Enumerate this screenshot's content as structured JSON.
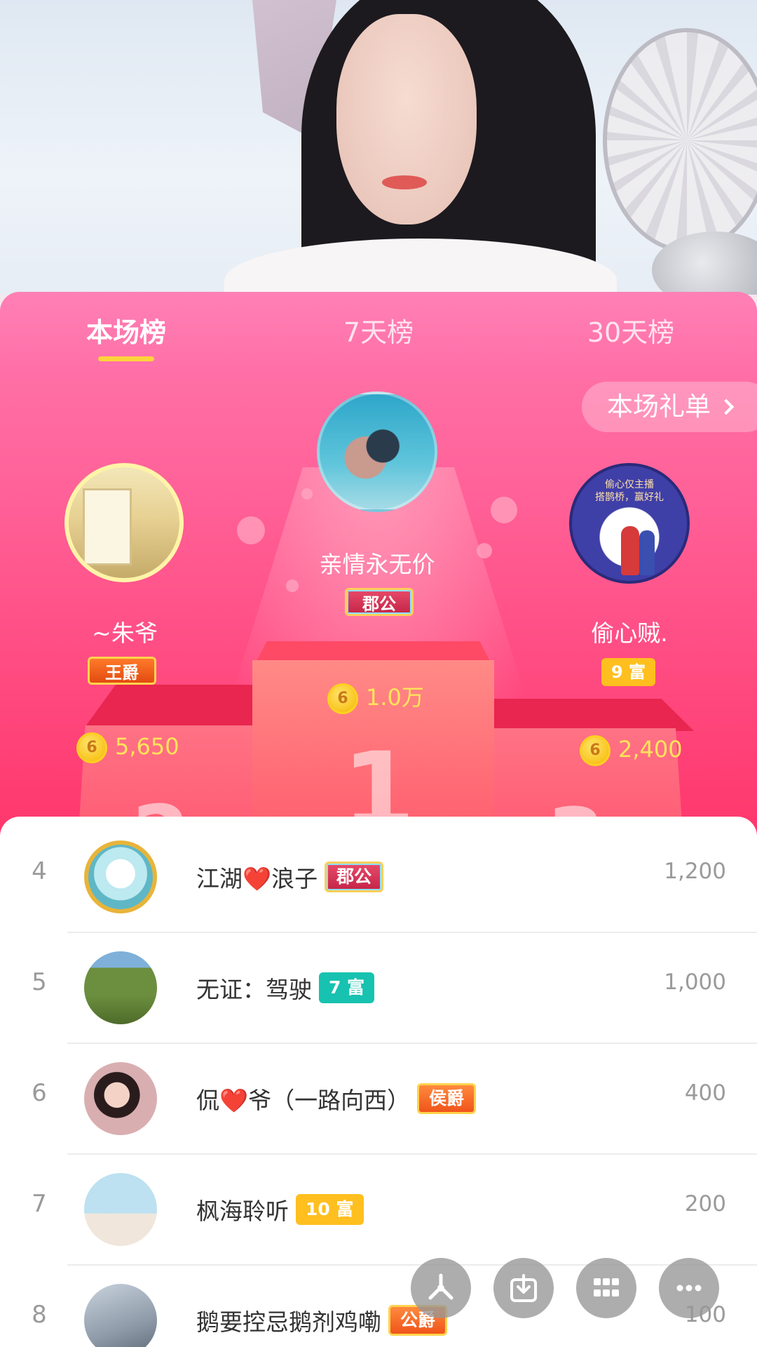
{
  "tabs": [
    {
      "label": "本场榜",
      "active": true
    },
    {
      "label": "7天榜",
      "active": false
    },
    {
      "label": "30天榜",
      "active": false
    }
  ],
  "gift_list_label": "本场礼单",
  "top3": {
    "first": {
      "rank": "1",
      "name": "亲情永无价",
      "badge": "郡公",
      "amount": "1.0万"
    },
    "second": {
      "rank": "2",
      "name": "~朱爷",
      "badge": "王爵",
      "amount": "5,650"
    },
    "third": {
      "rank": "3",
      "name": "偷心贼.",
      "badge": "9 富",
      "amount": "2,400"
    }
  },
  "third_avatar_text": "偷心仅主播\n搭鹊桥，赢好礼",
  "coin_symbol": "6",
  "list": [
    {
      "rank": "4",
      "name": "江湖❤️浪子",
      "badge": "郡公",
      "badge_type": "duke",
      "score": "1,200"
    },
    {
      "rank": "5",
      "name": "无证：驾驶",
      "badge": "7 富",
      "badge_type": "fu-teal",
      "score": "1,000"
    },
    {
      "rank": "6",
      "name": "侃❤️爷（一路向西）",
      "badge": "侯爵",
      "badge_type": "hou",
      "score": "400"
    },
    {
      "rank": "7",
      "name": "枫海聆听",
      "badge": "10 富",
      "badge_type": "fu-yellow",
      "score": "200"
    },
    {
      "rank": "8",
      "name": "鹅要控忌鹅剂鸡嘞",
      "badge": "公爵",
      "badge_type": "gong",
      "score": "100"
    }
  ],
  "fab_icons": [
    "share-icon",
    "download-icon",
    "grid-icon",
    "more-icon"
  ],
  "colors": {
    "tab_underline": "#ffd43b",
    "panel_pink": "#ff6097",
    "coin_gold": "#ffe45a"
  }
}
